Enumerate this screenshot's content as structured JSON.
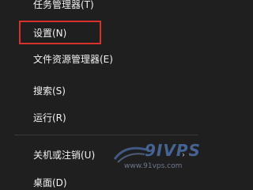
{
  "menu": {
    "items": [
      {
        "label": "任务管理器(T)"
      },
      {
        "label": "设置(N)"
      },
      {
        "label": "文件资源管理器(E)"
      },
      {
        "label": "搜索(S)"
      },
      {
        "label": "运行(R)"
      },
      {
        "label": "关机或注销(U)",
        "has_submenu": true
      },
      {
        "label": "桌面(D)"
      }
    ],
    "highlighted_item": "设置(N)",
    "highlight_color": "#d9302b",
    "background": "#1f1f1f"
  },
  "watermark": {
    "logo": "9IVPS",
    "url": "www.91vps.com"
  }
}
